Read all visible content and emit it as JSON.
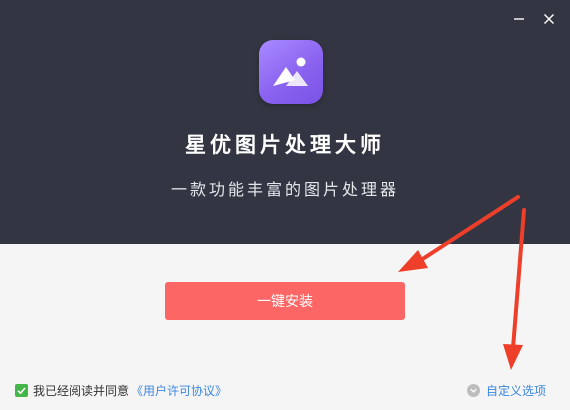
{
  "app": {
    "title": "星优图片处理大师",
    "subtitle": "一款功能丰富的图片处理器"
  },
  "window_controls": {
    "minimize_icon": "minimize-icon",
    "close_icon": "close-icon"
  },
  "main": {
    "install_label": "一键安装"
  },
  "footer": {
    "agree_text": "我已经阅读并同意",
    "license_link": "《用户许可协议》",
    "custom_options_label": "自定义选项",
    "checkbox_checked": true
  },
  "colors": {
    "header_bg": "#333642",
    "content_bg": "#f6f5f5",
    "install_button": "#fc6766",
    "link": "#3b86e0",
    "checkbox": "#45b649",
    "annotation_arrow": "#ee3f2b"
  }
}
